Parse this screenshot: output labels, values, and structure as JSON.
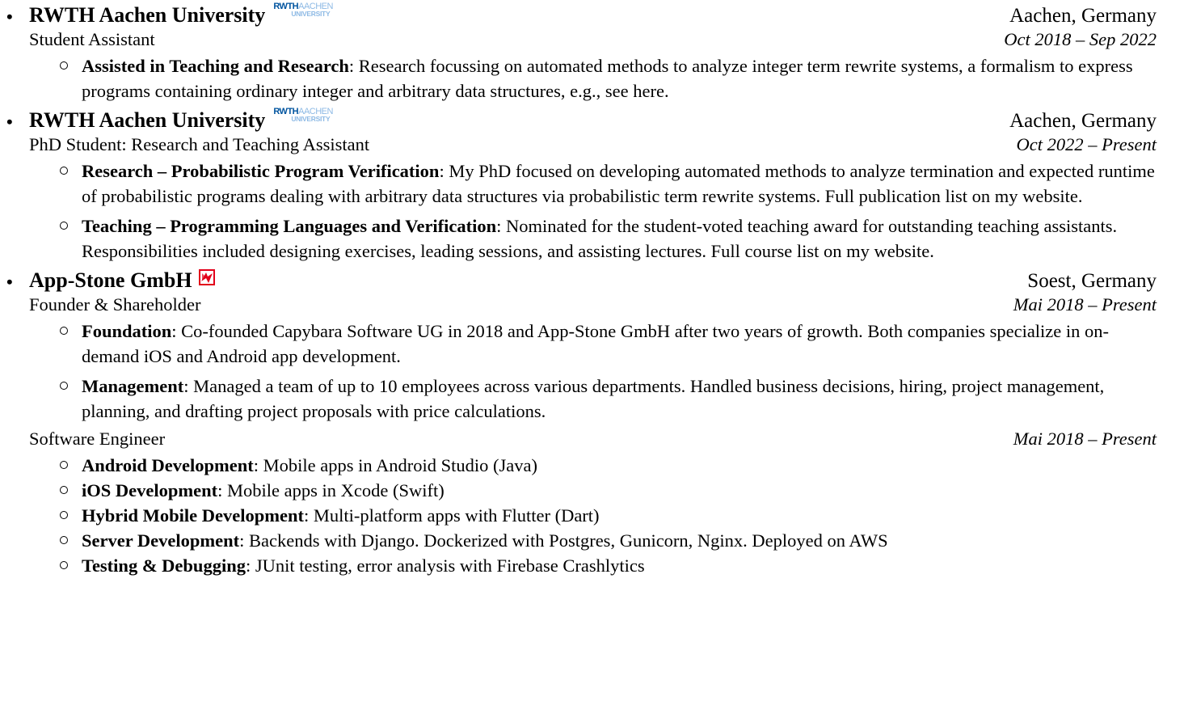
{
  "colors": {
    "rwth_blue": "#00549f",
    "rwth_light": "#8ebae5",
    "appstone_red": "#e2001a"
  },
  "entries": [
    {
      "org": "RWTH Aachen University",
      "logo": {
        "line1_bold": "RWTH",
        "line1_light": "AACHEN",
        "line2": "UNIVERSITY"
      },
      "location": "Aachen, Germany",
      "roles": [
        {
          "title": "Student Assistant",
          "dates": "Oct 2018 – Sep 2022",
          "items": [
            {
              "label": "Assisted in Teaching and Research",
              "text": ": Research focussing on automated methods to analyze integer term rewrite systems, a formalism to express programs containing ordinary integer and arbitrary data structures, e.g., see here."
            }
          ]
        }
      ]
    },
    {
      "org": "RWTH Aachen University",
      "logo": {
        "line1_bold": "RWTH",
        "line1_light": "AACHEN",
        "line2": "UNIVERSITY"
      },
      "location": "Aachen, Germany",
      "roles": [
        {
          "title": "PhD Student: Research and Teaching Assistant",
          "dates": "Oct 2022 – Present",
          "items": [
            {
              "label": "Research – Probabilistic Program Verification",
              "text": ": My PhD focused on developing automated methods to analyze termination and expected runtime of probabilistic programs dealing with arbitrary data structures via probabilistic term rewrite systems. Full publication list on my website."
            },
            {
              "label": "Teaching – Programming Languages and Verification",
              "text": ": Nominated for the student-voted teaching award for outstanding teaching assistants. Responsibilities included designing exercises, leading sessions, and assisting lectures. Full course list on my website."
            }
          ]
        }
      ]
    },
    {
      "org": "App-Stone GmbH",
      "location": "Soest, Germany",
      "roles": [
        {
          "title": "Founder & Shareholder",
          "dates": "Mai 2018 – Present",
          "items": [
            {
              "label": "Foundation",
              "text": ": Co-founded Capybara Software UG in 2018 and App-Stone GmbH after two years of growth. Both companies specialize in on-demand iOS and Android app development."
            },
            {
              "label": "Management",
              "text": ": Managed a team of up to 10 employees across various departments. Handled business decisions, hiring, project management, planning, and drafting project proposals with price calculations."
            }
          ]
        },
        {
          "title": "Software Engineer",
          "dates": "Mai 2018 – Present",
          "items": [
            {
              "label": "Android Development",
              "text": ": Mobile apps in Android Studio (Java)"
            },
            {
              "label": "iOS Development",
              "text": ": Mobile apps in Xcode (Swift)"
            },
            {
              "label": "Hybrid Mobile Development",
              "text": ": Multi-platform apps with Flutter (Dart)"
            },
            {
              "label": "Server Development",
              "text": ": Backends with Django. Dockerized with Postgres, Gunicorn, Nginx. Deployed on AWS"
            },
            {
              "label": "Testing & Debugging",
              "text": ": JUnit testing, error analysis with Firebase Crashlytics"
            }
          ]
        }
      ]
    }
  ]
}
